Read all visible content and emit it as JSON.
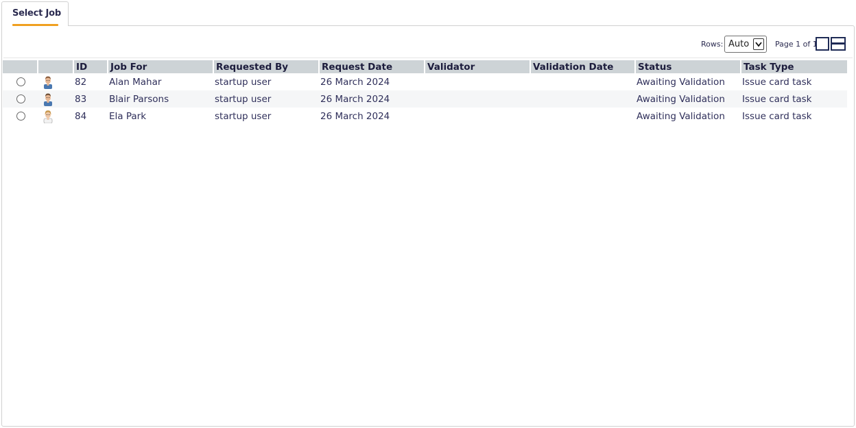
{
  "tab": {
    "label": "Select Job"
  },
  "toolbar": {
    "rows_label": "Rows:",
    "rows_value": "Auto",
    "page_label": "Page 1 of 1"
  },
  "table": {
    "headers": [
      "",
      "",
      "ID",
      "Job For",
      "Requested By",
      "Request Date",
      "Validator",
      "Validation Date",
      "Status",
      "Task Type"
    ],
    "rows": [
      {
        "id": "82",
        "job_for": "Alan Mahar",
        "requested_by": "startup user",
        "request_date": "26 March 2024",
        "validator": "",
        "validation_date": "",
        "status": "Awaiting Validation",
        "task_type": "Issue card task"
      },
      {
        "id": "83",
        "job_for": "Blair Parsons",
        "requested_by": "startup user",
        "request_date": "26 March 2024",
        "validator": "",
        "validation_date": "",
        "status": "Awaiting Validation",
        "task_type": "Issue card task"
      },
      {
        "id": "84",
        "job_for": "Ela Park",
        "requested_by": "startup user",
        "request_date": "26 March 2024",
        "validator": "",
        "validation_date": "",
        "status": "Awaiting Validation",
        "task_type": "Issue card task"
      }
    ]
  },
  "colors": {
    "accent": "#f0a020",
    "header_bg": "#cdd3d6",
    "text": "#2b2b50"
  },
  "icons": {
    "avatar": "person-avatar-icon",
    "dropdown": "chevron-down-icon",
    "single_view": "single-pane-view-icon",
    "split_view": "split-pane-view-icon"
  }
}
